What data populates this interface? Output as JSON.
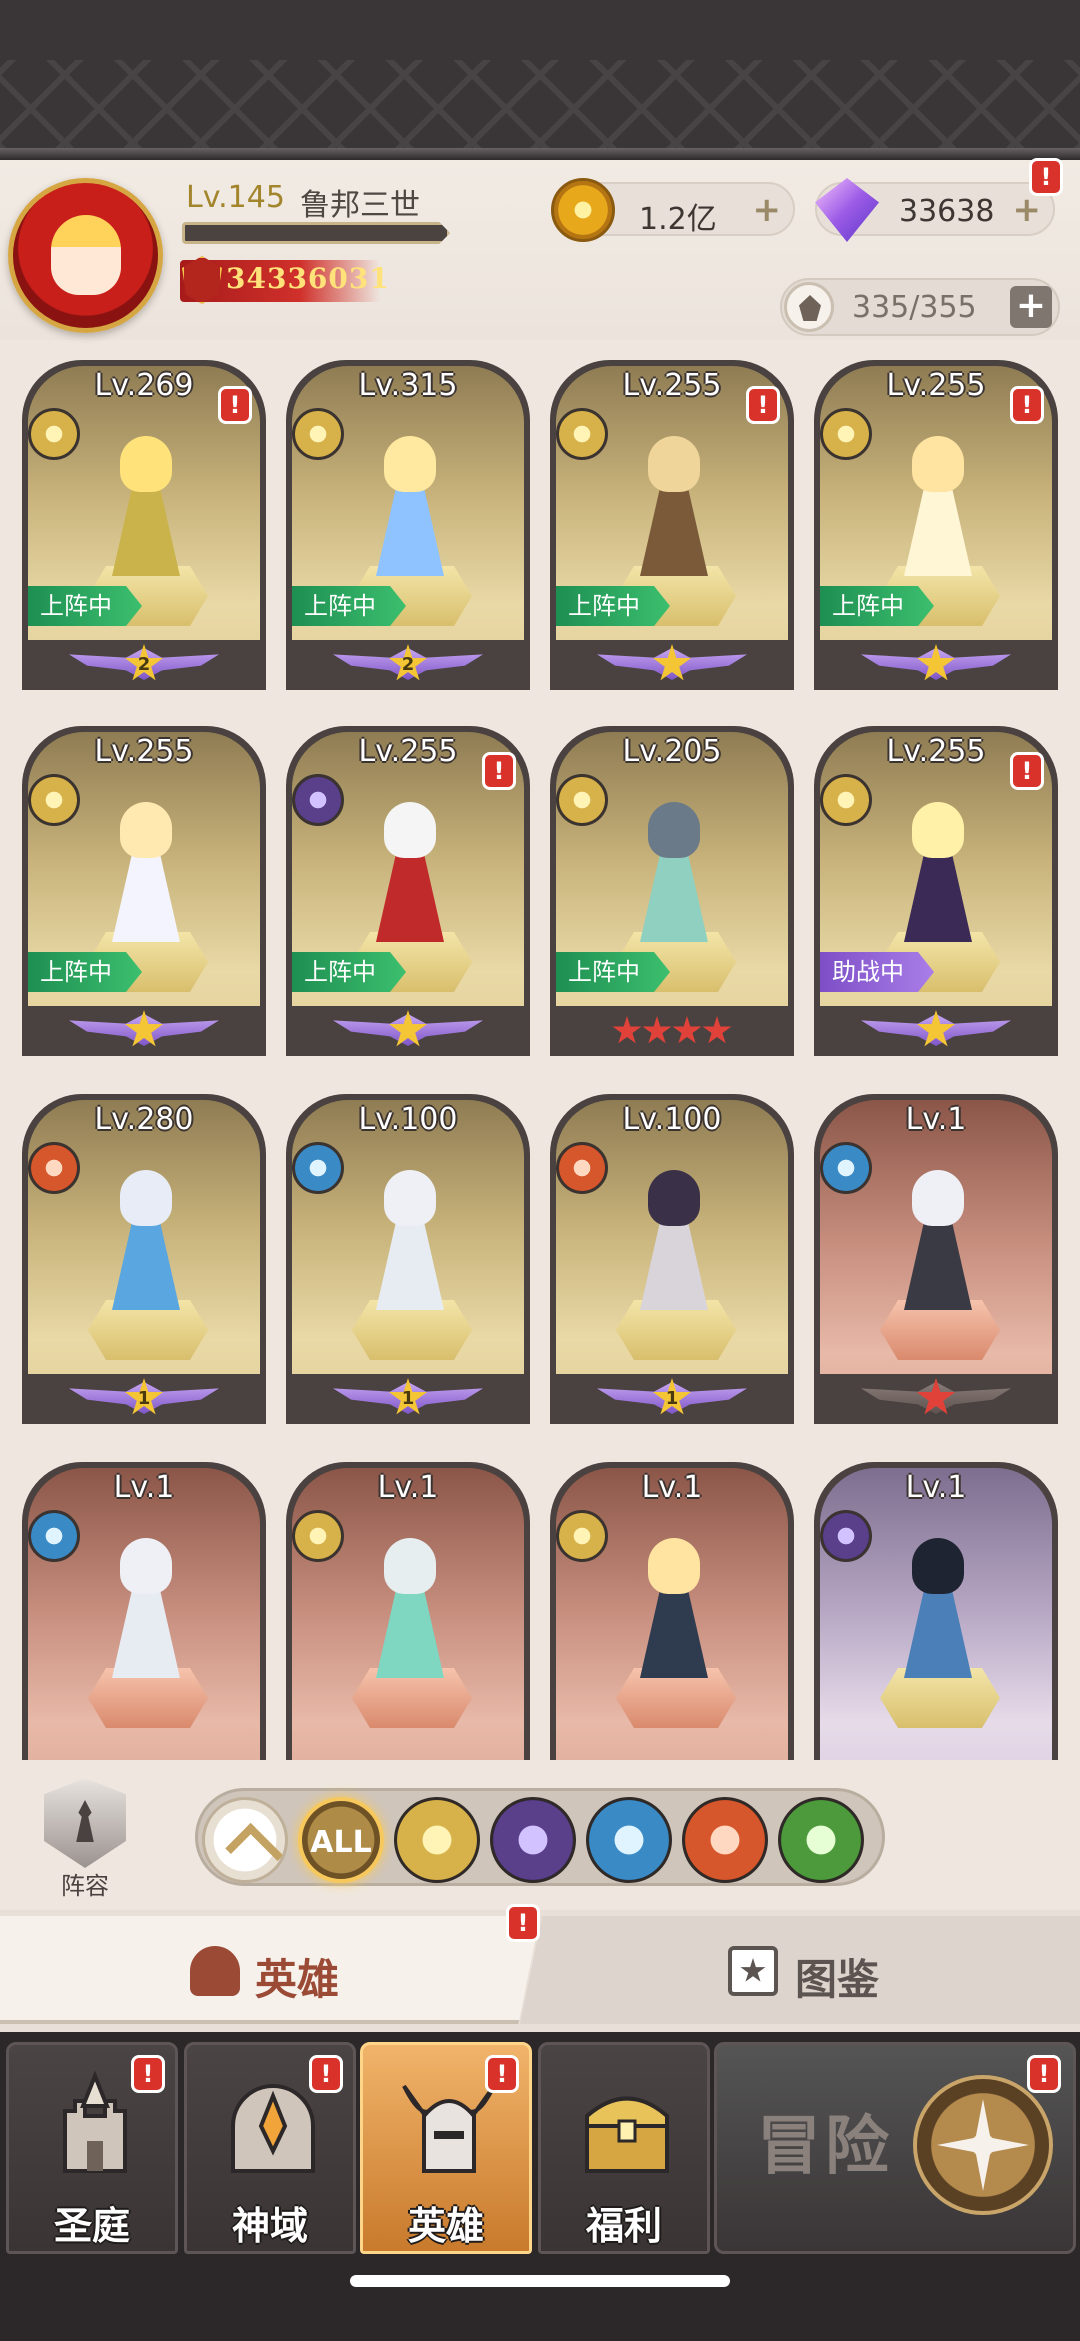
{
  "player": {
    "level": "Lv.145",
    "name": "鲁邦三世",
    "power": "34336031",
    "xp_fraction": 0.0
  },
  "resources": {
    "gold": "1.2亿",
    "gems": "33638",
    "roster": "335/355",
    "alert": "!"
  },
  "heroes": [
    {
      "level": "Lv.269",
      "faction": "light-faction-icon",
      "status": "上阵中",
      "star_count": "2",
      "alert": "!"
    },
    {
      "level": "Lv.315",
      "faction": "light-faction-icon",
      "status": "上阵中",
      "star_count": "2",
      "alert": ""
    },
    {
      "level": "Lv.255",
      "faction": "light-faction-icon",
      "status": "上阵中",
      "star_count": "",
      "alert": "!"
    },
    {
      "level": "Lv.255",
      "faction": "light-faction-icon",
      "status": "上阵中",
      "star_count": "",
      "alert": "!"
    },
    {
      "level": "Lv.255",
      "faction": "light-faction-icon",
      "status": "上阵中",
      "star_count": "",
      "alert": ""
    },
    {
      "level": "Lv.255",
      "faction": "dark-faction-icon",
      "status": "上阵中",
      "star_count": "",
      "alert": "!"
    },
    {
      "level": "Lv.205",
      "faction": "light-faction-icon",
      "status": "上阵中",
      "star_count": "",
      "alert": ""
    },
    {
      "level": "Lv.255",
      "faction": "light-faction-icon",
      "status": "助战中",
      "star_count": "",
      "alert": "!"
    },
    {
      "level": "Lv.280",
      "faction": "fire-faction-icon",
      "status": "",
      "star_count": "1",
      "alert": ""
    },
    {
      "level": "Lv.100",
      "faction": "water-faction-icon",
      "status": "",
      "star_count": "1",
      "alert": ""
    },
    {
      "level": "Lv.100",
      "faction": "fire-faction-icon",
      "status": "",
      "star_count": "1",
      "alert": ""
    },
    {
      "level": "Lv.1",
      "faction": "water-faction-icon",
      "status": "",
      "star_count": "",
      "alert": ""
    },
    {
      "level": "Lv.1",
      "faction": "water-faction-icon",
      "status": "",
      "star_count": "",
      "alert": ""
    },
    {
      "level": "Lv.1",
      "faction": "light-faction-icon",
      "status": "",
      "star_count": "",
      "alert": ""
    },
    {
      "level": "Lv.1",
      "faction": "light-faction-icon",
      "status": "",
      "star_count": "",
      "alert": ""
    },
    {
      "level": "Lv.1",
      "faction": "dark-faction-icon",
      "status": "",
      "star_count": "",
      "alert": ""
    }
  ],
  "filter": {
    "formation_label": "阵容",
    "all_label": "ALL",
    "factions": [
      "light-faction-icon",
      "dark-faction-icon",
      "water-faction-icon",
      "fire-faction-icon",
      "wind-faction-icon"
    ]
  },
  "tabs": {
    "heroes": "英雄",
    "codex": "图鉴",
    "alert": "!"
  },
  "nav": {
    "sanctum": "圣庭",
    "divine": "神域",
    "heroes": "英雄",
    "welfare": "福利",
    "adventure": "冒险",
    "alert": "!"
  },
  "colors": {
    "status_on": "#2fae63",
    "status_assist": "#9466dd",
    "notification": "#d9322b",
    "active_nav": "#e89a48"
  }
}
